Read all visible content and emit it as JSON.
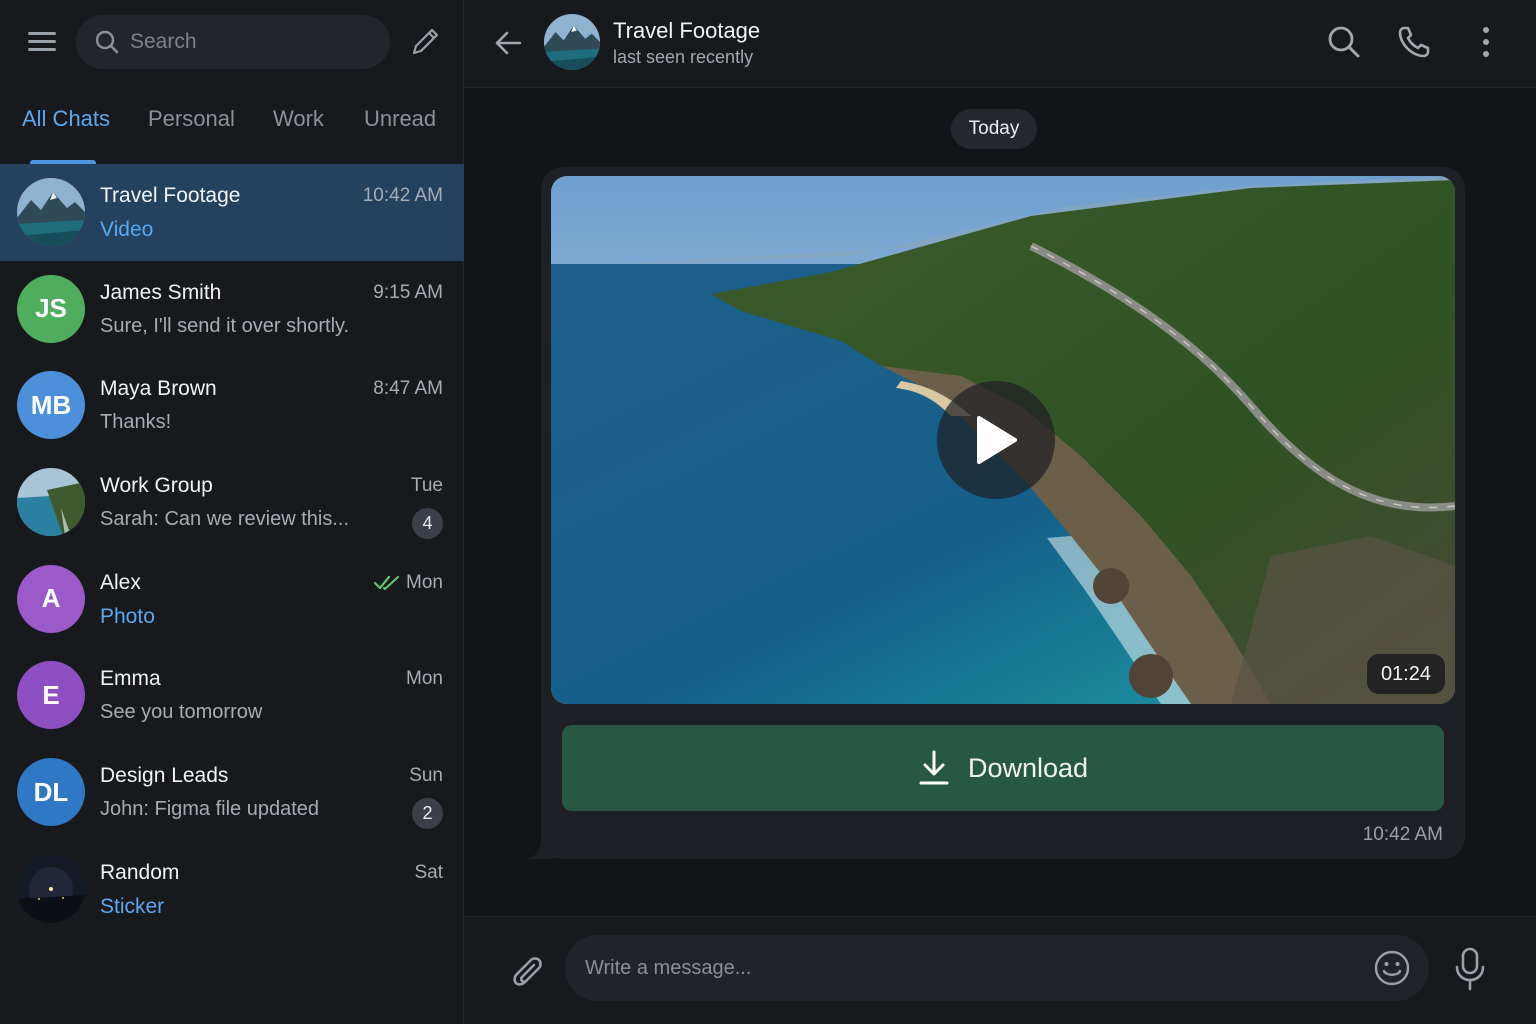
{
  "sidebar": {
    "search": {
      "placeholder": "Search"
    },
    "tabs": [
      {
        "label": "All Chats",
        "active": true
      },
      {
        "label": "Personal"
      },
      {
        "label": "Work"
      },
      {
        "label": "Unread"
      }
    ],
    "chats": [
      {
        "name": "Travel Footage",
        "preview": "Video",
        "time": "10:42 AM",
        "avatar_type": "landscape",
        "active": true
      },
      {
        "name": "James Smith",
        "preview": "Sure, I'll send it over shortly.",
        "time": "9:15 AM",
        "initials": "JS",
        "avatar_color": "#4fae5e"
      },
      {
        "name": "Maya Brown",
        "preview": "Thanks!",
        "time": "8:47 AM",
        "initials": "MB",
        "avatar_color": "#4b90d8"
      },
      {
        "name": "Work Group",
        "preview": "Sarah: Can we review this...",
        "time": "Tue",
        "unread": "4",
        "avatar_type": "landscape"
      },
      {
        "name": "Alex",
        "preview": "Photo",
        "time": "Mon",
        "initials": "A",
        "avatar_color": "#9b59c9",
        "read_receipt": "double-check-icon"
      },
      {
        "name": "Emma",
        "preview": "See you tomorrow",
        "time": "Mon",
        "initials": "E",
        "avatar_color": "#8d4fc2"
      },
      {
        "name": "Design Leads",
        "preview": "John: Figma file updated",
        "time": "Sun",
        "unread": "2",
        "initials": "DL",
        "avatar_color": "#2f79c4"
      },
      {
        "name": "Random",
        "preview": "Sticker",
        "time": "Sat",
        "avatar_type": "night"
      }
    ]
  },
  "header": {
    "title": "Travel Footage",
    "status": "last seen recently"
  },
  "conversation": {
    "date_label": "Today",
    "message": {
      "type": "video",
      "duration": "01:24",
      "download_label": "Download",
      "time": "10:42 AM"
    }
  },
  "composer": {
    "placeholder": "Write a message..."
  },
  "colors": {
    "accent": "#5aa8f0",
    "active_chat_bg": "#24415f",
    "download_bg": "#275843",
    "read_check": "#5cc46c"
  }
}
